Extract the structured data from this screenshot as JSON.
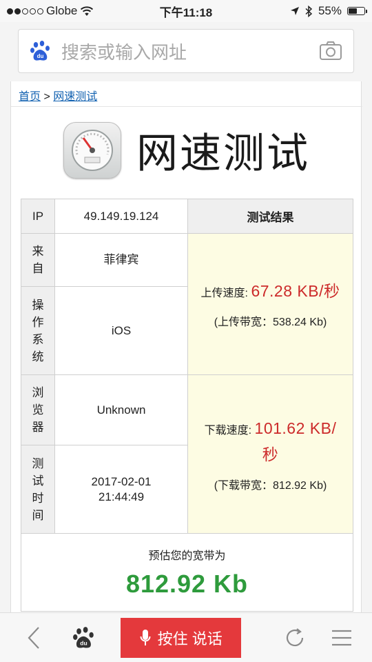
{
  "status_bar": {
    "carrier": "Globe",
    "time": "下午11:18",
    "battery_percent": "55%",
    "battery_level": 0.55
  },
  "search": {
    "placeholder": "搜索或输入网址",
    "left_icon": "baidu-paw-icon",
    "right_icon": "camera-icon"
  },
  "breadcrumb": {
    "home": "首页",
    "separator": ">",
    "current": "网速测试"
  },
  "header": {
    "title": "网速测试",
    "icon": "speedometer-icon"
  },
  "table": {
    "ip_label": "IP",
    "ip_value": "49.149.19.124",
    "result_header": "测试结果",
    "from_label": "来自",
    "from_value": "菲律宾",
    "os_label": "操作系统",
    "os_value": "iOS",
    "browser_label": "浏览器",
    "browser_value": "Unknown",
    "time_label": "测试时间",
    "time_date": "2017-02-01",
    "time_clock": "21:44:49",
    "upload_label": "上传速度:",
    "upload_value": "67.28 KB/秒",
    "upload_bandwidth": "(上传带宽：538.24 Kb)",
    "download_label": "下载速度:",
    "download_value": "101.62 KB/秒",
    "download_bandwidth": "(下载带宽：812.92 Kb)",
    "estimate_label": "预估您的宽带为",
    "estimate_value": "812.92 Kb"
  },
  "toolbar": {
    "back_icon": "back-chevron-icon",
    "home_icon": "baidu-paw-icon",
    "voice_label": "按住 说话",
    "refresh_icon": "refresh-icon",
    "menu_icon": "menu-icon"
  },
  "colors": {
    "accent_red": "#e4393c",
    "speed_red": "#cc2a2a",
    "estimate_green": "#2e9b3c",
    "link_blue": "#1060b0",
    "baidu_blue": "#2d5fd8",
    "result_bg": "#fdfce3"
  }
}
